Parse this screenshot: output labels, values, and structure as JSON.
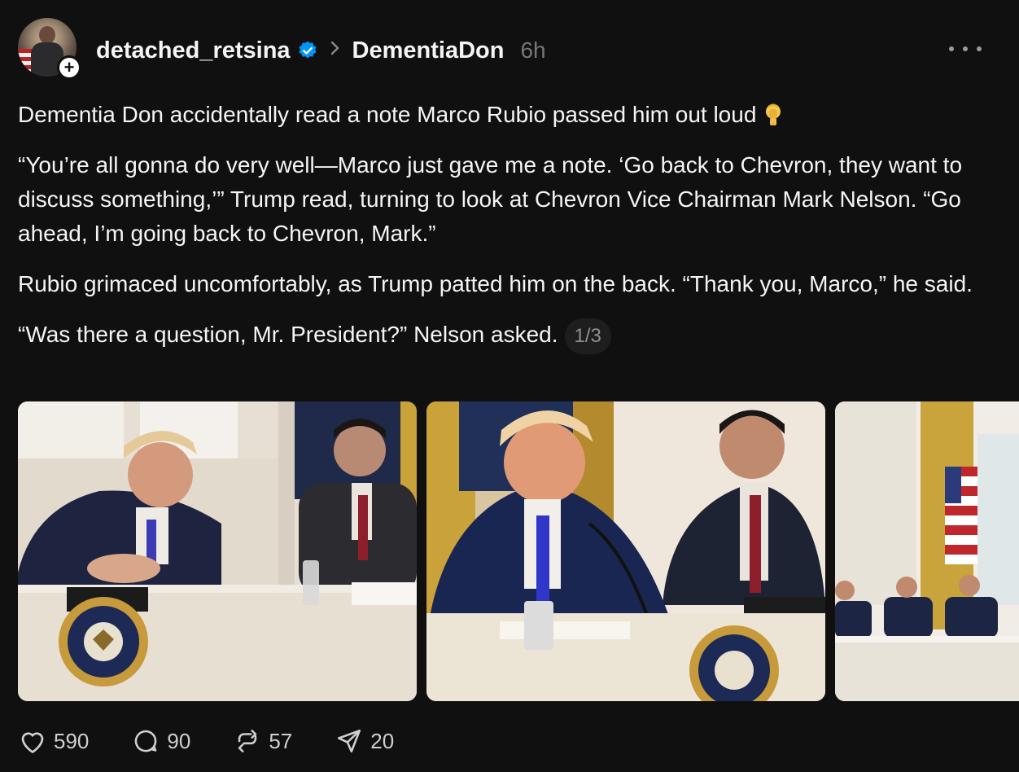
{
  "header": {
    "username": "detached_retsina",
    "verified_icon": "verified-badge-icon",
    "separator_icon": "chevron-right-icon",
    "community": "DementiaDon",
    "time": "6h",
    "more_icon": "more-horizontal-icon"
  },
  "body": {
    "paragraphs": [
      "Dementia Don accidentally read a note Marco Rubio passed him out loud",
      "“You’re all gonna do very well—Marco just gave me a note. ‘Go back to Chevron, they want to discuss something,’” Trump read, turning to look at Chevron Vice Chairman Mark Nelson. “Go ahead, I’m going back to Chevron, Mark.”",
      "Rubio grimaced uncomfortably, as Trump patted him on the back. “Thank you, Marco,” he said.",
      "“Was there a question, Mr. President?” Nelson asked."
    ],
    "emoji_icon": "facepalm-emoji-icon",
    "image_counter": "1/3"
  },
  "media": {
    "images": [
      {
        "name": "photo-1"
      },
      {
        "name": "photo-2"
      },
      {
        "name": "photo-3"
      }
    ]
  },
  "actions": {
    "likes": "590",
    "replies": "90",
    "reposts": "57",
    "shares": "20"
  },
  "colors": {
    "background": "#101010",
    "text": "#f3f5f7",
    "muted": "#777777",
    "verified": "#0095f6"
  }
}
